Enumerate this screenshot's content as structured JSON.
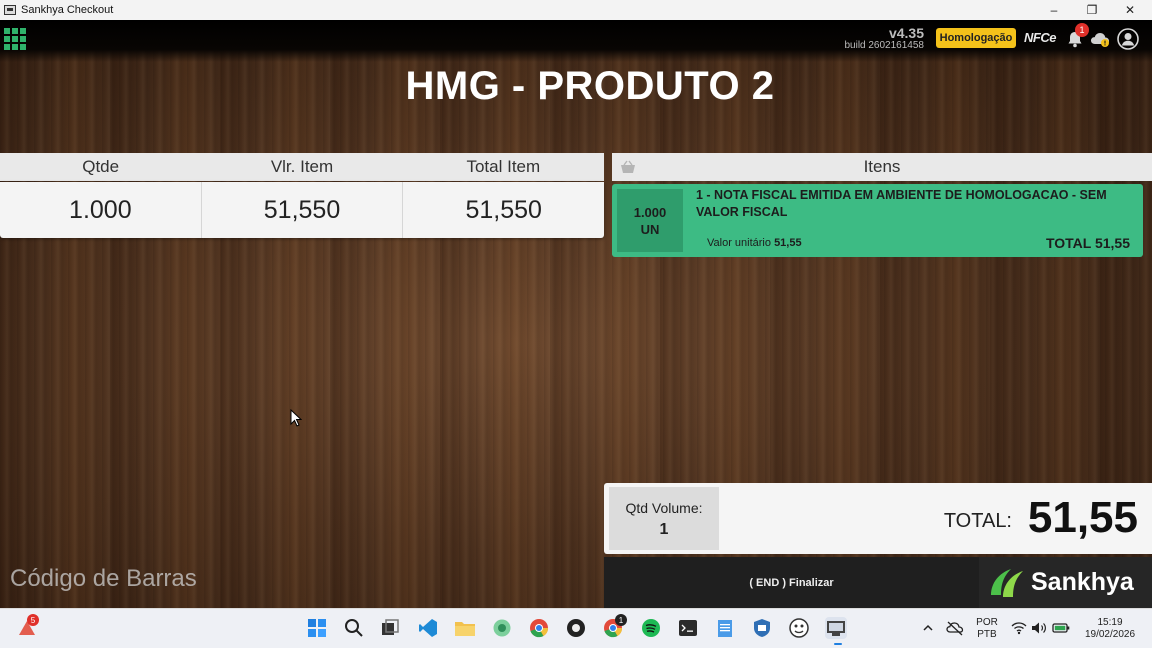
{
  "window": {
    "title": "Sankhya Checkout",
    "minimize": "–",
    "maximize": "❐",
    "close": "✕"
  },
  "header": {
    "version": "v4.35",
    "build": "build 2602161458",
    "environment_badge": "Homologação",
    "nfce_label": "NFCe",
    "notification_count": "1"
  },
  "product_title": "HMG - PRODUTO 2",
  "item_table": {
    "headers": [
      "Qtde",
      "Vlr. Item",
      "Total Item"
    ],
    "values": [
      "1.000",
      "51,550",
      "51,550"
    ]
  },
  "items_panel": {
    "header": "Itens",
    "items": [
      {
        "qty": "1.000",
        "unit": "UN",
        "description": "1 -  NOTA FISCAL EMITIDA EM AMBIENTE DE HOMOLOGACAO - SEM VALOR FISCAL",
        "unit_price_label": "Valor unitário",
        "unit_price": "51,55",
        "total": "TOTAL 51,55"
      }
    ]
  },
  "totals": {
    "volume_label": "Qtd Volume:",
    "volume_value": "1",
    "total_label": "TOTAL:",
    "total_value": "51,55"
  },
  "finalize_button": "( END ) Finalizar",
  "brand_name": "Sankhya",
  "barcode_placeholder": "Código de Barras",
  "taskbar": {
    "weather_badge": "5",
    "chrome2_badge": "1",
    "lang_top": "POR",
    "lang_bottom": "PTB",
    "time": "15:19",
    "date": "19/02/2026"
  },
  "colors": {
    "accent_green": "#3dbb84",
    "badge_yellow": "#f4c21a",
    "grid_icon": "#2fb36b"
  }
}
